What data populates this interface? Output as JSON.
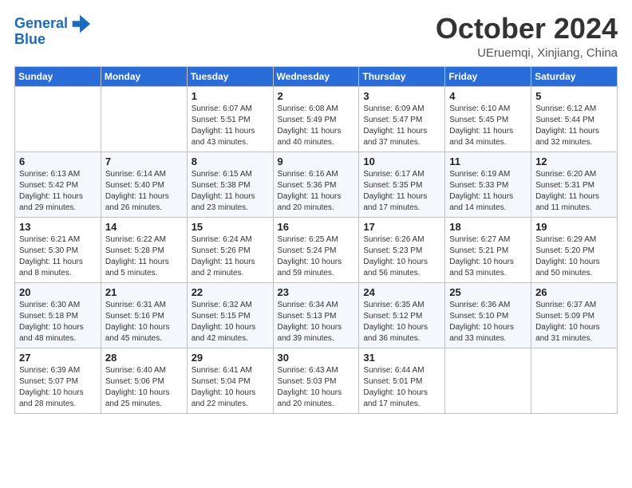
{
  "header": {
    "logo_line1": "General",
    "logo_line2": "Blue",
    "month_title": "October 2024",
    "location": "UEruemqi, Xinjiang, China"
  },
  "days_of_week": [
    "Sunday",
    "Monday",
    "Tuesday",
    "Wednesday",
    "Thursday",
    "Friday",
    "Saturday"
  ],
  "weeks": [
    [
      {
        "day": "",
        "content": ""
      },
      {
        "day": "",
        "content": ""
      },
      {
        "day": "1",
        "content": "Sunrise: 6:07 AM\nSunset: 5:51 PM\nDaylight: 11 hours\nand 43 minutes."
      },
      {
        "day": "2",
        "content": "Sunrise: 6:08 AM\nSunset: 5:49 PM\nDaylight: 11 hours\nand 40 minutes."
      },
      {
        "day": "3",
        "content": "Sunrise: 6:09 AM\nSunset: 5:47 PM\nDaylight: 11 hours\nand 37 minutes."
      },
      {
        "day": "4",
        "content": "Sunrise: 6:10 AM\nSunset: 5:45 PM\nDaylight: 11 hours\nand 34 minutes."
      },
      {
        "day": "5",
        "content": "Sunrise: 6:12 AM\nSunset: 5:44 PM\nDaylight: 11 hours\nand 32 minutes."
      }
    ],
    [
      {
        "day": "6",
        "content": "Sunrise: 6:13 AM\nSunset: 5:42 PM\nDaylight: 11 hours\nand 29 minutes."
      },
      {
        "day": "7",
        "content": "Sunrise: 6:14 AM\nSunset: 5:40 PM\nDaylight: 11 hours\nand 26 minutes."
      },
      {
        "day": "8",
        "content": "Sunrise: 6:15 AM\nSunset: 5:38 PM\nDaylight: 11 hours\nand 23 minutes."
      },
      {
        "day": "9",
        "content": "Sunrise: 6:16 AM\nSunset: 5:36 PM\nDaylight: 11 hours\nand 20 minutes."
      },
      {
        "day": "10",
        "content": "Sunrise: 6:17 AM\nSunset: 5:35 PM\nDaylight: 11 hours\nand 17 minutes."
      },
      {
        "day": "11",
        "content": "Sunrise: 6:19 AM\nSunset: 5:33 PM\nDaylight: 11 hours\nand 14 minutes."
      },
      {
        "day": "12",
        "content": "Sunrise: 6:20 AM\nSunset: 5:31 PM\nDaylight: 11 hours\nand 11 minutes."
      }
    ],
    [
      {
        "day": "13",
        "content": "Sunrise: 6:21 AM\nSunset: 5:30 PM\nDaylight: 11 hours\nand 8 minutes."
      },
      {
        "day": "14",
        "content": "Sunrise: 6:22 AM\nSunset: 5:28 PM\nDaylight: 11 hours\nand 5 minutes."
      },
      {
        "day": "15",
        "content": "Sunrise: 6:24 AM\nSunset: 5:26 PM\nDaylight: 11 hours\nand 2 minutes."
      },
      {
        "day": "16",
        "content": "Sunrise: 6:25 AM\nSunset: 5:24 PM\nDaylight: 10 hours\nand 59 minutes."
      },
      {
        "day": "17",
        "content": "Sunrise: 6:26 AM\nSunset: 5:23 PM\nDaylight: 10 hours\nand 56 minutes."
      },
      {
        "day": "18",
        "content": "Sunrise: 6:27 AM\nSunset: 5:21 PM\nDaylight: 10 hours\nand 53 minutes."
      },
      {
        "day": "19",
        "content": "Sunrise: 6:29 AM\nSunset: 5:20 PM\nDaylight: 10 hours\nand 50 minutes."
      }
    ],
    [
      {
        "day": "20",
        "content": "Sunrise: 6:30 AM\nSunset: 5:18 PM\nDaylight: 10 hours\nand 48 minutes."
      },
      {
        "day": "21",
        "content": "Sunrise: 6:31 AM\nSunset: 5:16 PM\nDaylight: 10 hours\nand 45 minutes."
      },
      {
        "day": "22",
        "content": "Sunrise: 6:32 AM\nSunset: 5:15 PM\nDaylight: 10 hours\nand 42 minutes."
      },
      {
        "day": "23",
        "content": "Sunrise: 6:34 AM\nSunset: 5:13 PM\nDaylight: 10 hours\nand 39 minutes."
      },
      {
        "day": "24",
        "content": "Sunrise: 6:35 AM\nSunset: 5:12 PM\nDaylight: 10 hours\nand 36 minutes."
      },
      {
        "day": "25",
        "content": "Sunrise: 6:36 AM\nSunset: 5:10 PM\nDaylight: 10 hours\nand 33 minutes."
      },
      {
        "day": "26",
        "content": "Sunrise: 6:37 AM\nSunset: 5:09 PM\nDaylight: 10 hours\nand 31 minutes."
      }
    ],
    [
      {
        "day": "27",
        "content": "Sunrise: 6:39 AM\nSunset: 5:07 PM\nDaylight: 10 hours\nand 28 minutes."
      },
      {
        "day": "28",
        "content": "Sunrise: 6:40 AM\nSunset: 5:06 PM\nDaylight: 10 hours\nand 25 minutes."
      },
      {
        "day": "29",
        "content": "Sunrise: 6:41 AM\nSunset: 5:04 PM\nDaylight: 10 hours\nand 22 minutes."
      },
      {
        "day": "30",
        "content": "Sunrise: 6:43 AM\nSunset: 5:03 PM\nDaylight: 10 hours\nand 20 minutes."
      },
      {
        "day": "31",
        "content": "Sunrise: 6:44 AM\nSunset: 5:01 PM\nDaylight: 10 hours\nand 17 minutes."
      },
      {
        "day": "",
        "content": ""
      },
      {
        "day": "",
        "content": ""
      }
    ]
  ]
}
